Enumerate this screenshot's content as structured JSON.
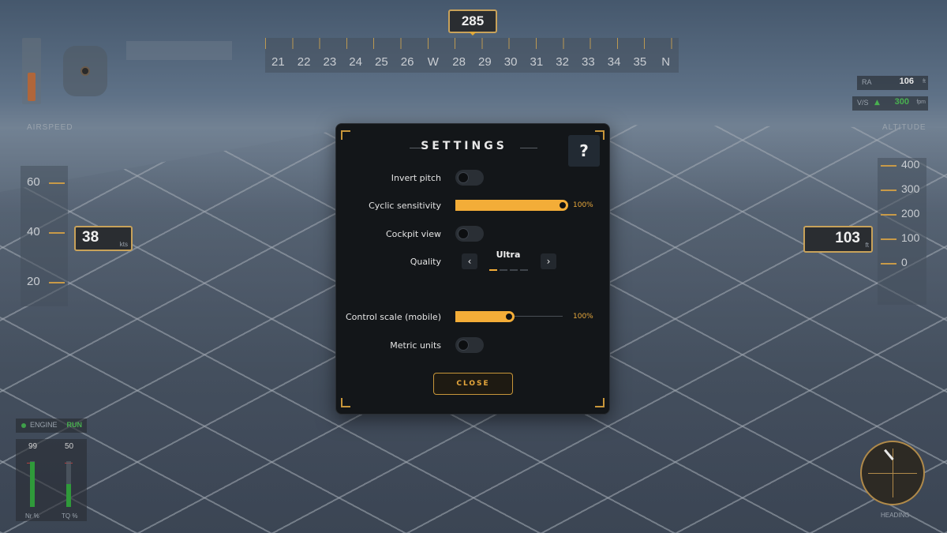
{
  "hud": {
    "heading": "285",
    "compass_labels": [
      "21",
      "22",
      "23",
      "24",
      "25",
      "26",
      "W",
      "28",
      "29",
      "30",
      "31",
      "32",
      "33",
      "34",
      "35",
      "N"
    ],
    "airspeed_label": "AIRSPEED",
    "speed_tape": [
      "60",
      "40",
      "20"
    ],
    "airspeed_value": "38",
    "airspeed_unit": "kts",
    "ra_label": "RA",
    "ra_value": "106",
    "ra_unit": "ft",
    "vs_label": "V/S",
    "vs_value": "300",
    "vs_unit": "fpm",
    "altitude_label": "ALTITUDE",
    "alt_tape": [
      "400",
      "300",
      "200",
      "100",
      "0"
    ],
    "altitude_value": "103",
    "altitude_unit": "ft",
    "engine_label": "ENGINE",
    "engine_status": "RUN",
    "nr_value": "99",
    "tq_value": "50",
    "nr_label": "Nr %",
    "tq_label": "TQ %",
    "nr_level": 0.99,
    "tq_level": 0.5,
    "compass_dial_label": "HEADING"
  },
  "settings": {
    "title": "SETTINGS",
    "help_label": "?",
    "invert_pitch_label": "Invert pitch",
    "invert_pitch_on": false,
    "cyclic_label": "Cyclic sensitivity",
    "cyclic_value": "100%",
    "cyclic_level": 1.0,
    "cockpit_view_label": "Cockpit view",
    "cockpit_view_on": false,
    "quality_label": "Quality",
    "quality_value": "Ultra",
    "quality_prev": "‹",
    "quality_next": "›",
    "quality_index": 0,
    "quality_count": 4,
    "control_scale_label": "Control scale (mobile)",
    "control_scale_value": "100%",
    "control_scale_level": 0.5,
    "metric_units_label": "Metric units",
    "metric_units_on": false,
    "close_label": "CLOSE"
  },
  "colors": {
    "accent": "#f3ad38",
    "frame": "#c8963a",
    "dialog_bg": "#131619"
  }
}
